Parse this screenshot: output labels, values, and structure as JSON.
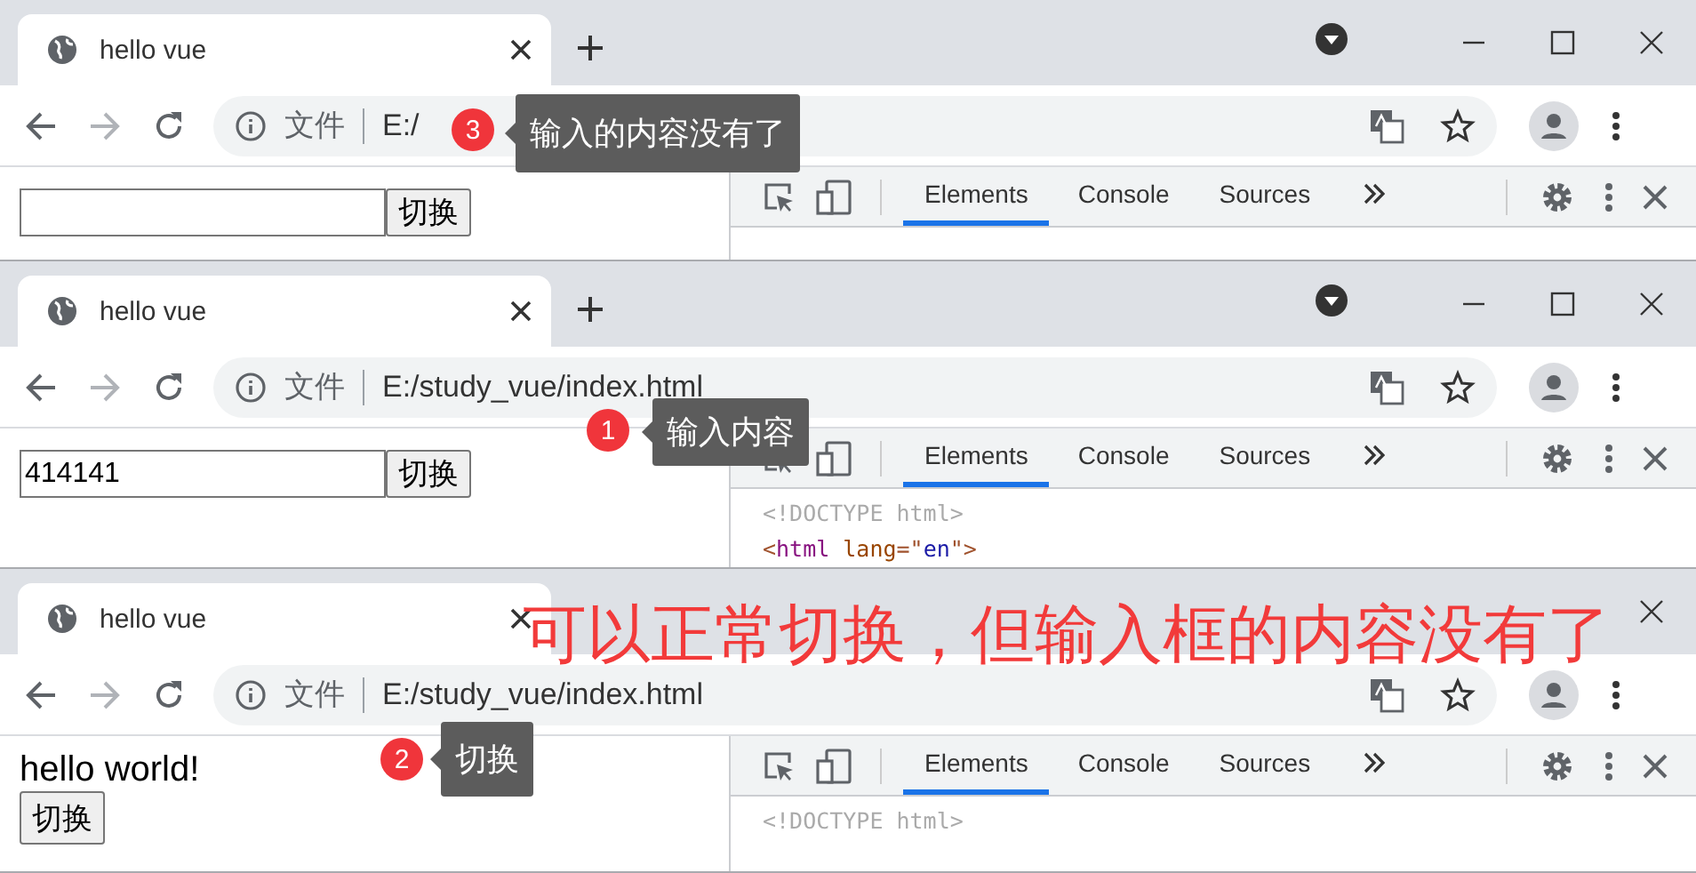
{
  "windows": [
    {
      "tab": {
        "title": "hello vue",
        "selected": true
      },
      "address": {
        "scheme_label": "文件",
        "url": "E:/"
      },
      "page": {
        "kind": "form",
        "button": "切换"
      },
      "devtools": {
        "tabs": [
          {
            "label": "Elements",
            "selected": true
          },
          {
            "label": "Console",
            "selected": false
          },
          {
            "label": "Sources",
            "selected": false
          }
        ]
      },
      "annotation": {
        "number": "3",
        "text": "输入的内容没有了"
      }
    },
    {
      "tab": {
        "title": "hello vue",
        "selected": true
      },
      "address": {
        "scheme_label": "文件",
        "url": "E:/study_vue/index.html"
      },
      "page": {
        "kind": "form",
        "input_value": "414141",
        "button": "切换"
      },
      "devtools": {
        "tabs": [
          {
            "label": "Elements",
            "selected": true
          },
          {
            "label": "Console",
            "selected": false
          },
          {
            "label": "Sources",
            "selected": false
          }
        ],
        "code": [
          [
            {
              "kind": "doctype",
              "text": "<!DOCTYPE html>"
            }
          ],
          [
            {
              "kind": "punct",
              "text": "<"
            },
            {
              "kind": "tag",
              "text": "html"
            },
            {
              "kind": "attr",
              "text": "lang",
              "spaced": true
            },
            {
              "kind": "punct",
              "text": "=\""
            },
            {
              "kind": "value",
              "text": "en"
            },
            {
              "kind": "punct",
              "text": "\">"
            }
          ]
        ]
      },
      "annotation": {
        "number": "1",
        "text": "输入内容"
      }
    },
    {
      "tab": {
        "title": "hello vue",
        "selected": true
      },
      "address": {
        "scheme_label": "文件",
        "url": "E:/study_vue/index.html"
      },
      "page": {
        "kind": "text",
        "text": "hello world!",
        "button": "切换"
      },
      "devtools": {
        "tabs": [
          {
            "label": "Elements",
            "selected": true
          },
          {
            "label": "Console",
            "selected": false
          },
          {
            "label": "Sources",
            "selected": false
          }
        ],
        "code": [
          [
            {
              "kind": "doctype",
              "text": "<!DOCTYPE html>"
            }
          ]
        ]
      },
      "annotation": {
        "number": "2",
        "text": "切换"
      }
    }
  ],
  "caption": "可以正常切换，但输入框的内容没有了"
}
